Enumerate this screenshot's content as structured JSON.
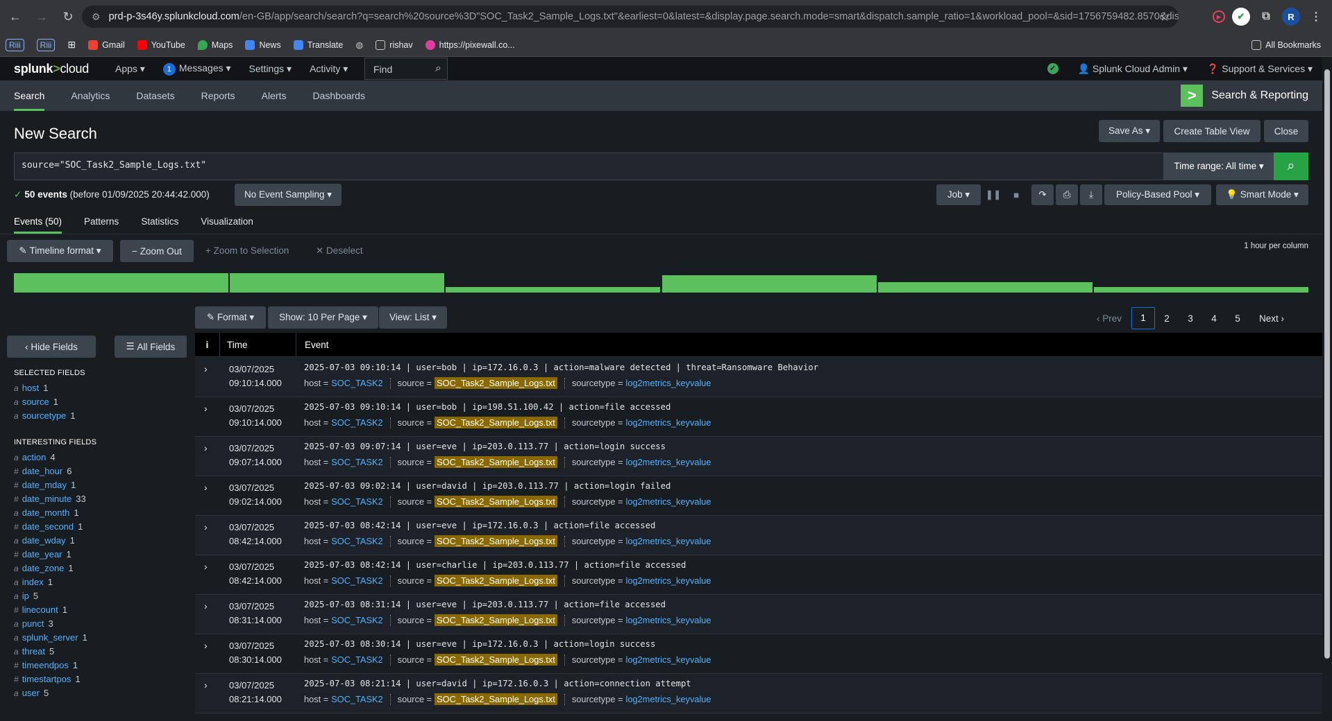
{
  "browser": {
    "url_host": "prd-p-3s46y.splunkcloud.com",
    "url_path": "/en-GB/app/search/search?q=search%20source%3D\"SOC_Task2_Sample_Logs.txt\"&earliest=0&latest=&display.page.search.mode=smart&dispatch.sample_ratio=1&workload_pool=&sid=1756759482.8570&display...",
    "profile_initial": "R",
    "bookmarks": [
      "Riii",
      "Riii",
      "Gmail",
      "YouTube",
      "Maps",
      "News",
      "Translate",
      "rishav",
      "https://pixewall.co..."
    ],
    "all_bookmarks": "All Bookmarks"
  },
  "splunk": {
    "logo_main": "splunk",
    "logo_gt": ">",
    "logo_cloud": "cloud",
    "menu": {
      "apps": "Apps ▾",
      "messages_count": "1",
      "messages": "Messages ▾",
      "settings": "Settings ▾",
      "activity": "Activity ▾"
    },
    "find": "Find",
    "user": "Splunk Cloud Admin ▾",
    "support": "Support & Services ▾"
  },
  "appbar": {
    "tabs": [
      "Search",
      "Analytics",
      "Datasets",
      "Reports",
      "Alerts",
      "Dashboards"
    ],
    "app_title": "Search & Reporting"
  },
  "search": {
    "title": "New Search",
    "save_as": "Save As ▾",
    "create_table": "Create Table View",
    "close": "Close",
    "query": "source=\"SOC_Task2_Sample_Logs.txt\"",
    "time_range": "Time range: All time ▾",
    "events_count": "50 events",
    "events_before": "(before 01/09/2025 20:44:42.000)",
    "sampling": "No Event Sampling ▾",
    "job": "Job ▾",
    "pool": "Policy-Based Pool ▾",
    "mode": "Smart Mode ▾"
  },
  "results_tabs": [
    "Events (50)",
    "Patterns",
    "Statistics",
    "Visualization"
  ],
  "timeline": {
    "format": "Timeline format ▾",
    "zoom_out": "− Zoom Out",
    "zoom_sel": "+ Zoom to Selection",
    "deselect": "✕ Deselect",
    "per_column": "1 hour per column",
    "bars": [
      1.0,
      1.0,
      0.3,
      0.9,
      0.55,
      0.3
    ]
  },
  "list_controls": {
    "format": "Format ▾",
    "show": "Show: 10 Per Page ▾",
    "view": "View: List ▾",
    "prev": "‹ Prev",
    "pages": [
      "1",
      "2",
      "3",
      "4",
      "5"
    ],
    "next": "Next ›"
  },
  "sidebar": {
    "hide_fields": "‹ Hide Fields",
    "all_fields": "All Fields",
    "selected_header": "SELECTED FIELDS",
    "selected": [
      {
        "type": "a",
        "name": "host",
        "count": "1"
      },
      {
        "type": "a",
        "name": "source",
        "count": "1"
      },
      {
        "type": "a",
        "name": "sourcetype",
        "count": "1"
      }
    ],
    "interesting_header": "INTERESTING FIELDS",
    "interesting": [
      {
        "type": "a",
        "name": "action",
        "count": "4"
      },
      {
        "type": "#",
        "name": "date_hour",
        "count": "6"
      },
      {
        "type": "#",
        "name": "date_mday",
        "count": "1"
      },
      {
        "type": "#",
        "name": "date_minute",
        "count": "33"
      },
      {
        "type": "a",
        "name": "date_month",
        "count": "1"
      },
      {
        "type": "#",
        "name": "date_second",
        "count": "1"
      },
      {
        "type": "a",
        "name": "date_wday",
        "count": "1"
      },
      {
        "type": "#",
        "name": "date_year",
        "count": "1"
      },
      {
        "type": "a",
        "name": "date_zone",
        "count": "1"
      },
      {
        "type": "a",
        "name": "index",
        "count": "1"
      },
      {
        "type": "a",
        "name": "ip",
        "count": "5"
      },
      {
        "type": "#",
        "name": "linecount",
        "count": "1"
      },
      {
        "type": "a",
        "name": "punct",
        "count": "3"
      },
      {
        "type": "a",
        "name": "splunk_server",
        "count": "1"
      },
      {
        "type": "a",
        "name": "threat",
        "count": "5"
      },
      {
        "type": "#",
        "name": "timeendpos",
        "count": "1"
      },
      {
        "type": "#",
        "name": "timestartpos",
        "count": "1"
      },
      {
        "type": "a",
        "name": "user",
        "count": "5"
      }
    ]
  },
  "table": {
    "col_i": "i",
    "col_time": "Time",
    "col_event": "Event",
    "host_label": "host =",
    "source_label": "source =",
    "sourcetype_label": "sourcetype =",
    "host": "SOC_TASK2",
    "source": "SOC_Task2_Sample_Logs.txt",
    "sourcetype": "log2metrics_keyvalue",
    "events": [
      {
        "date": "03/07/2025",
        "time": "09:10:14.000",
        "raw": "2025-07-03 09:10:14 | user=bob | ip=172.16.0.3 | action=malware detected | threat=Ransomware Behavior"
      },
      {
        "date": "03/07/2025",
        "time": "09:10:14.000",
        "raw": "2025-07-03 09:10:14 | user=bob | ip=198.51.100.42 | action=file accessed"
      },
      {
        "date": "03/07/2025",
        "time": "09:07:14.000",
        "raw": "2025-07-03 09:07:14 | user=eve | ip=203.0.113.77 | action=login success"
      },
      {
        "date": "03/07/2025",
        "time": "09:02:14.000",
        "raw": "2025-07-03 09:02:14 | user=david | ip=203.0.113.77 | action=login failed"
      },
      {
        "date": "03/07/2025",
        "time": "08:42:14.000",
        "raw": "2025-07-03 08:42:14 | user=eve | ip=172.16.0.3 | action=file accessed"
      },
      {
        "date": "03/07/2025",
        "time": "08:42:14.000",
        "raw": "2025-07-03 08:42:14 | user=charlie | ip=203.0.113.77 | action=file accessed"
      },
      {
        "date": "03/07/2025",
        "time": "08:31:14.000",
        "raw": "2025-07-03 08:31:14 | user=eve | ip=203.0.113.77 | action=file accessed"
      },
      {
        "date": "03/07/2025",
        "time": "08:30:14.000",
        "raw": "2025-07-03 08:30:14 | user=eve | ip=172.16.0.3 | action=login success"
      },
      {
        "date": "03/07/2025",
        "time": "08:21:14.000",
        "raw": "2025-07-03 08:21:14 | user=david | ip=172.16.0.3 | action=connection attempt"
      }
    ]
  }
}
